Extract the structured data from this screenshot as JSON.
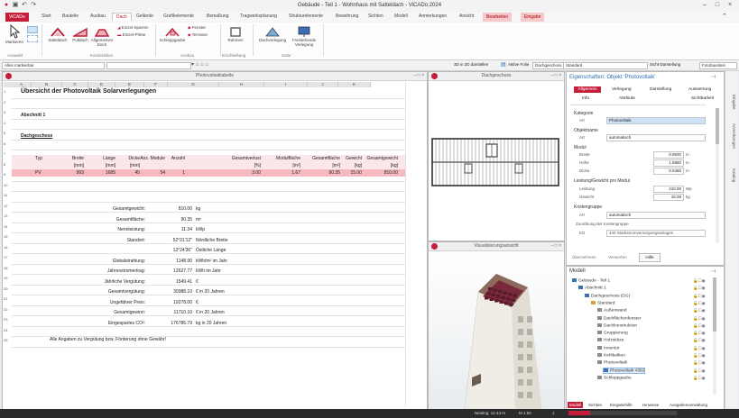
{
  "app": {
    "title": "Gebäude - Teil 1 - Wohnhaus mit Satteldach - ViCADo.2024",
    "quick_access": [
      "save-icon",
      "undo-icon",
      "redo-icon"
    ],
    "window_buttons": [
      "–",
      "□",
      "×"
    ]
  },
  "ribbon_tabs": [
    "ViCADo",
    "Start",
    "Bauteile",
    "Ausbau",
    "Dach",
    "Gelände",
    "Grafikelemente",
    "Bemaßung",
    "Tragwerksplanung",
    "Strukturelemente",
    "Bewehrung",
    "Sichten",
    "Modell",
    "Anmerkungen",
    "Ansicht",
    "Bearbeiten",
    "Eingabe"
  ],
  "ribbon": {
    "markieren": "Markieren",
    "auswahl": "Auswahl",
    "satteldach": "Satteldach",
    "pultdach": "Pultdach",
    "allgemeines_dach": "Allgemeines Dach",
    "einzel_sparren": "Einzel-Sparren",
    "einzel_pfette": "Einzel-Pfette",
    "konstruktion": "Konstruktion",
    "schleppgaube": "Schleppgaube",
    "fenster": "Fenster",
    "terrasse": "Terrasse",
    "ausbau": "Ausbau",
    "rahmen": "Rahmen",
    "dachverlegung": "Dachverlegung",
    "freistehende_verlegung": "Freistehende Verlegung",
    "erschliessung": "Erschließung",
    "solar": "Solar"
  },
  "propsbar": {
    "layer_combo": "Alles markierbar",
    "mode_3d": "3D in 2D darstellen",
    "aktive_folie": "Aktive Folie",
    "folie_combo": "Dachgeschoss",
    "standard_combo": "Standard",
    "sicht_label": "Sicht-Darstellung",
    "sicht_combo": "Fotobaustein"
  },
  "spreadsheet": {
    "title": "Photovoltaiktabelle",
    "columns": [
      "A",
      "B",
      "C",
      "D",
      "E",
      "F",
      "G",
      "H",
      "I",
      "J",
      "K"
    ],
    "rows": [
      "1",
      "2",
      "3",
      "4",
      "5",
      "6",
      "7",
      "8",
      "9",
      "10",
      "11",
      "12",
      "13",
      "14",
      "15",
      "16",
      "17",
      "18",
      "19",
      "20",
      "21",
      "22",
      "23",
      "24",
      "25"
    ],
    "heading": "Übersicht  der Photovoltaik Solarverlegungen",
    "section": "Abschnitt 1",
    "floor": "Dachgeschoss",
    "headers": [
      "Typ",
      "Breite",
      "Länge",
      "Dicke",
      "Anz. Module",
      "Anzahl",
      "Gesamtverlust",
      "Modulfläche",
      "Gesamtfläche",
      "Gewicht",
      "Gesamtgewicht"
    ],
    "units": [
      "[mm]",
      "[mm]",
      "[mm]",
      "[%]",
      "[m²]",
      "[m²]",
      "[kg]",
      "[kg]"
    ],
    "pv_row": [
      "PV",
      "993",
      "1685",
      "45",
      "54",
      "1",
      "3.00",
      "1.67",
      "90.35",
      "15.00",
      "810.00"
    ],
    "summary": [
      {
        "label": "Gesamtgewicht:",
        "value": "810.00",
        "unit": "kg"
      },
      {
        "label": "Gesamtfläche:",
        "value": "90.35",
        "unit": "m²"
      },
      {
        "label": "Nennleistung:",
        "value": "11.34",
        "unit": "kWp"
      },
      {
        "label": "Standort:",
        "value": "52°31'12\"",
        "unit": "Nördliche Breite"
      },
      {
        "label": "",
        "value": "13°24'36\"",
        "unit": "Östliche Länge"
      },
      {
        "label": "Globalstrahlung:",
        "value": "1148.00",
        "unit": "kWh/m² im Jahr"
      },
      {
        "label": "Jahresstromertrag:",
        "value": "12627.77",
        "unit": "kWh im Jahr"
      },
      {
        "label": "Jährliche Vergütung:",
        "value": "1549.41",
        "unit": "€"
      },
      {
        "label": "Gesamtvergütung:",
        "value": "30988.10",
        "unit": "€ in 20 Jahren"
      },
      {
        "label": "Ungefährer Preis:",
        "value": "19278.00",
        "unit": "€"
      },
      {
        "label": "Gesamtgewinn:",
        "value": "11710.10",
        "unit": "€ in 20 Jahren"
      },
      {
        "label": "Eingespartes CO²:",
        "value": "176786.79",
        "unit": "kg in 20 Jahren"
      }
    ],
    "footnote": "Alle Angaben zu Vergütung bzw. Förderung ohne Gewähr!"
  },
  "view_top": {
    "title": "Dachgeschoss"
  },
  "view_3d": {
    "title": "Visualisierungsansicht"
  },
  "properties": {
    "title": "Eigenschaften: Objekt 'Photovoltaik'",
    "tabs_row1": [
      "Allgemein",
      "Verlegung",
      "Darstellung",
      "Auswertung"
    ],
    "tabs_row2": [
      "Info",
      "Attribute",
      "Sichtbarkeit"
    ],
    "kategorie_header": "Kategorie",
    "art_label": "Art",
    "kategorie_value": "Photovoltaik",
    "objektname_header": "Objektname",
    "objektname_art": "automatisch",
    "modul_header": "Modul",
    "breite_label": "Breite",
    "breite_value": "0.9930",
    "hoehe_label": "Höhe",
    "hoehe_value": "1.6850",
    "dicke_label": "Dicke",
    "dicke_value": "0.0450",
    "unit_m": "m",
    "leistung_header": "Leistung/Gewicht pro Modul",
    "leistung_label": "Leistung",
    "leistung_value": "210.00",
    "leistung_unit": "Wp",
    "gewicht_label": "Gewicht",
    "gewicht_value": "15.00",
    "gewicht_unit": "kg",
    "kostengruppe_header": "Kostengruppe",
    "kostengruppe_art": "automatisch",
    "zuordnung_label": "Zuordnung der Kostengruppe",
    "kg_label": "KG",
    "kg_value": "440 Starkstromversorgungsanlagen",
    "bottom_tabs": [
      "Übernehmen",
      "Verwerfen",
      "Hilfe"
    ]
  },
  "model": {
    "title": "Modell",
    "tree": [
      {
        "label": "Gebäude - Teil 1",
        "indent": 0,
        "icon": "building-icon"
      },
      {
        "label": "Abschnitt 1",
        "indent": 1,
        "icon": "section-icon"
      },
      {
        "label": "Dachgeschoss (DG)",
        "indent": 2,
        "icon": "floor-icon"
      },
      {
        "label": "Standard",
        "indent": 3,
        "icon": "folder-icon"
      },
      {
        "label": "Außenwand",
        "indent": 4,
        "icon": "layer-icon"
      },
      {
        "label": "Dachflächenfenster",
        "indent": 4,
        "icon": "layer-icon"
      },
      {
        "label": "Dachkonstruktion",
        "indent": 4,
        "icon": "layer-icon"
      },
      {
        "label": "Gruppierung",
        "indent": 4,
        "icon": "layer-icon"
      },
      {
        "label": "Holzstütze",
        "indent": 4,
        "icon": "layer-icon"
      },
      {
        "label": "Innentür",
        "indent": 4,
        "icon": "layer-icon"
      },
      {
        "label": "Kehlbalken",
        "indent": 4,
        "icon": "layer-icon"
      },
      {
        "label": "Photovoltaik",
        "indent": 4,
        "icon": "layer-icon"
      },
      {
        "label": "Photovoltaik 4302",
        "indent": 5,
        "icon": "pv-icon"
      },
      {
        "label": "Schleppgaube",
        "indent": 4,
        "icon": "layer-icon"
      }
    ],
    "bottom_tabs": [
      "Modell",
      "Sichten",
      "Eingabehilfe",
      "Hinweise",
      "Ausgabenverwaltung"
    ]
  },
  "side_tabs": [
    "Eingabe",
    "Anmerkungen",
    "Katalog"
  ],
  "statusbar": {
    "nesting": "Nesting: 12.43 m",
    "scale": "M 1:50",
    "count": "1"
  }
}
